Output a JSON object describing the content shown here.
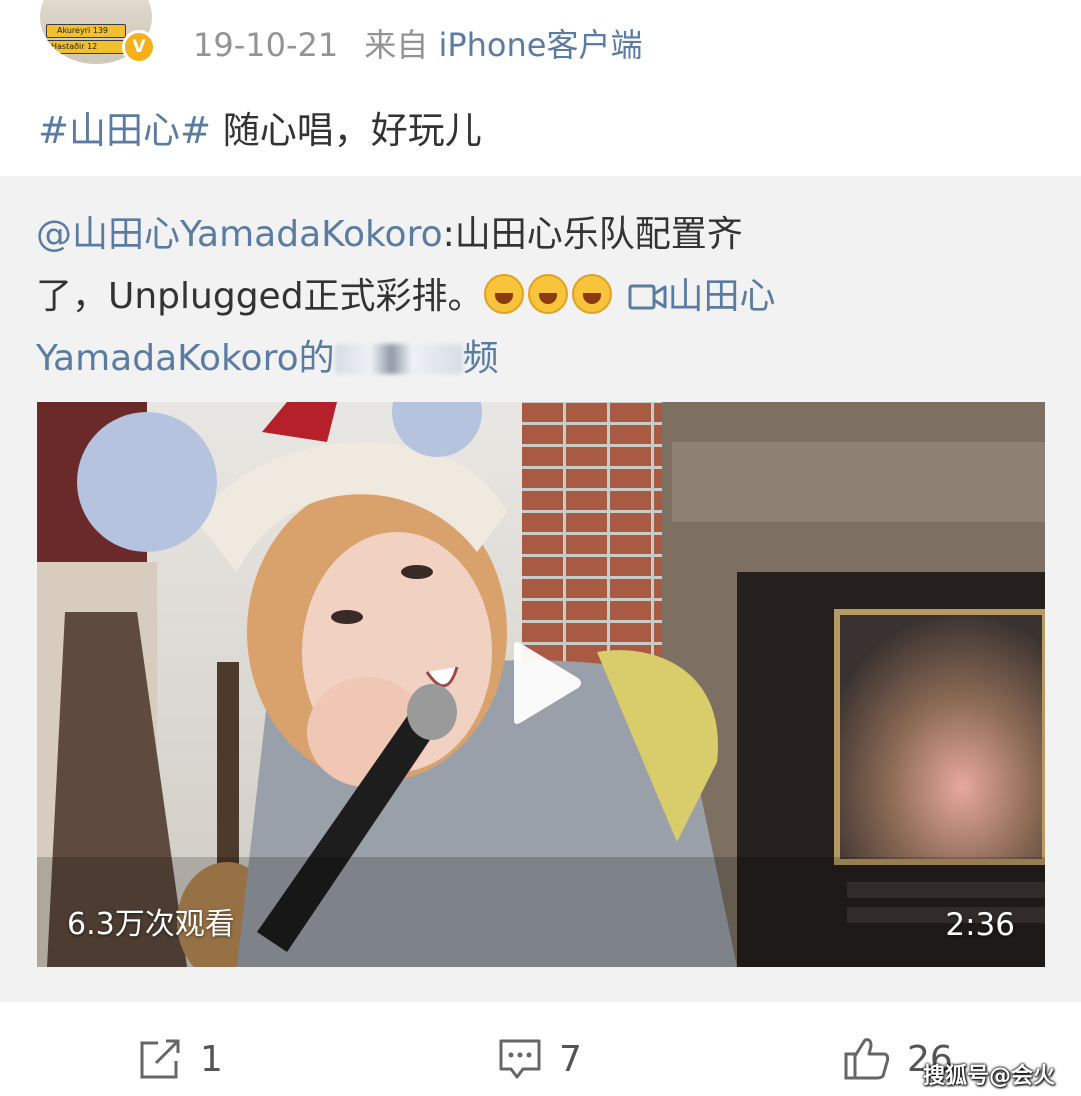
{
  "post": {
    "date": "19-10-21",
    "source_prefix": "来自",
    "source_client": "iPhone客户端",
    "hashtag": "#山田心#",
    "text": "随心唱，好玩儿"
  },
  "avatar_sign": {
    "line1": "Akureyri 139",
    "line2": "Hastaðir 12"
  },
  "repost": {
    "mention": "@山田心YamadaKokoro",
    "text_line1_rest": ":山田心乐队配置齐",
    "text_line2": "了，Unplugged正式彩排。",
    "emojis": [
      "grin-emoji",
      "laughing-tears-emoji",
      "laughing-tears-emoji"
    ],
    "video_link_line1": "山田心",
    "video_link_line2_start": "YamadaKokoro的",
    "video_link_line2_end": "频"
  },
  "video": {
    "views": "6.3万次观看",
    "duration": "2:36"
  },
  "actions": {
    "repost_count": "1",
    "comment_count": "7",
    "like_count": "26"
  },
  "watermark": "搜狐号@会火",
  "colors": {
    "link": "#5a7ca3",
    "meta": "#939393",
    "card_bg": "#f2f2f2",
    "verified": "#f6b01c"
  }
}
